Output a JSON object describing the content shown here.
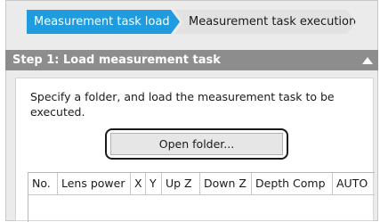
{
  "steps": {
    "active": "Measurement task load",
    "next": "Measurement task execution"
  },
  "section": {
    "title": "Step 1: Load measurement task",
    "description": "Specify a folder, and load the measurement task to be executed.",
    "open_folder_label": "Open folder..."
  },
  "table": {
    "columns": [
      "No.",
      "Lens power",
      "X",
      "Y",
      "Up Z",
      "Down Z",
      "Depth Comp",
      "AUTO"
    ]
  },
  "colors": {
    "active_step": "#1f9be0",
    "section_header": "#8d8d8d"
  }
}
